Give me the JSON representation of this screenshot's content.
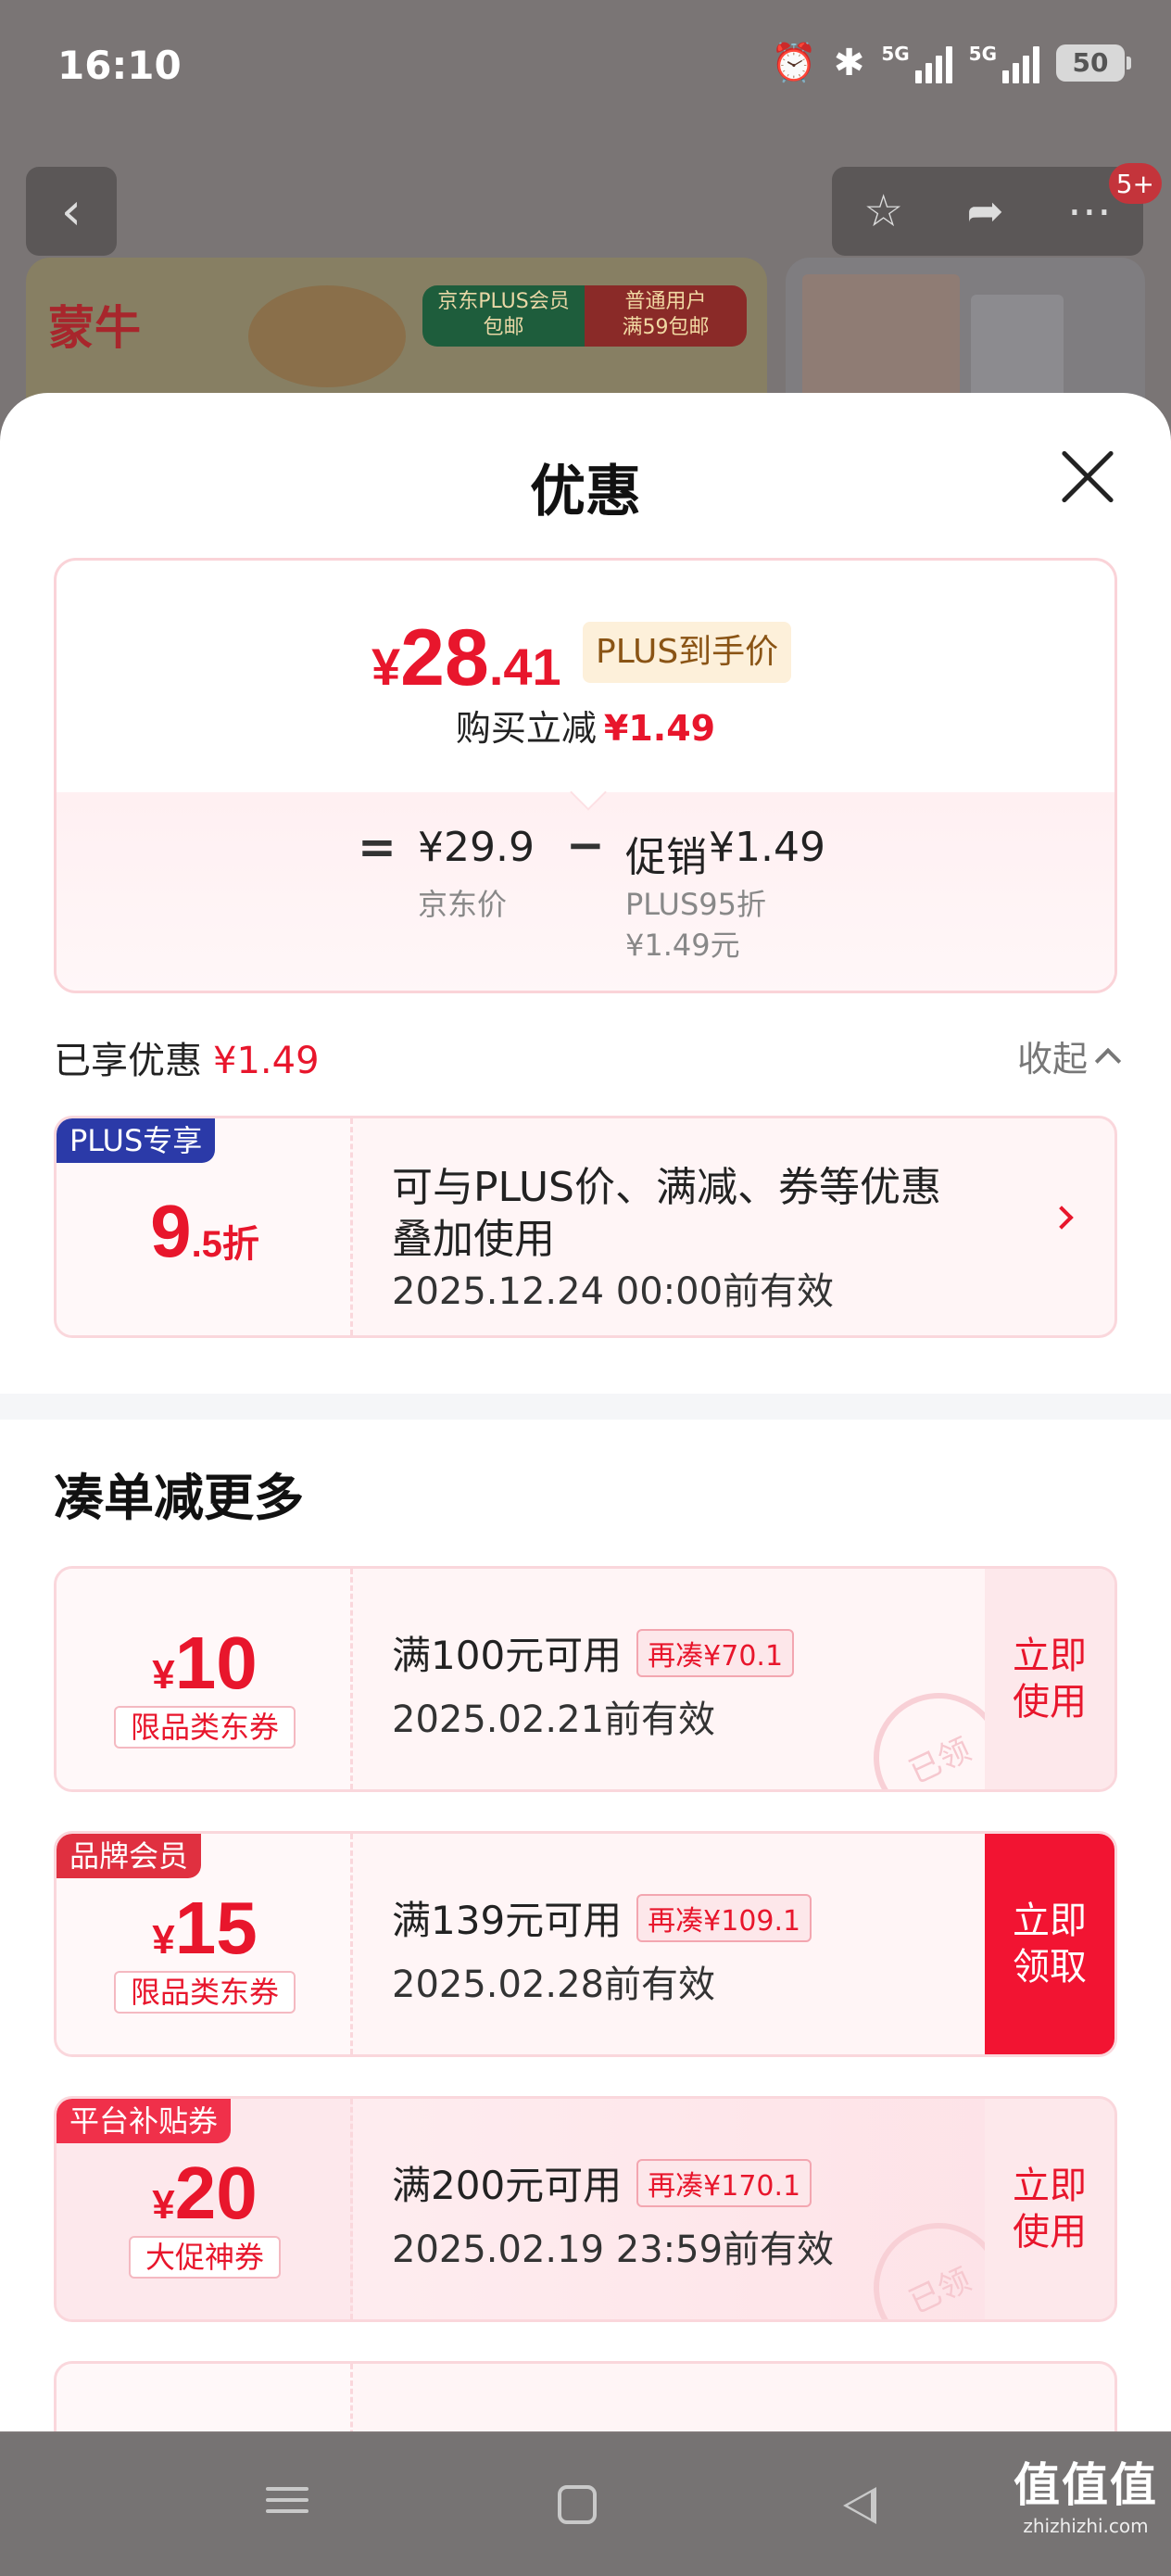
{
  "status_bar": {
    "time": "16:10",
    "alarm_icon": "alarm-icon",
    "bluetooth_icon": "bluetooth-icon",
    "signal_labels": [
      "5G",
      "5G"
    ],
    "battery": "50"
  },
  "background": {
    "brand": "蒙牛",
    "badge_left_line1": "京东PLUS会员",
    "badge_left_line2": "包邮",
    "badge_right_line1": "普通用户",
    "badge_right_line2": "满59包邮",
    "notification_badge": "5+"
  },
  "sheet": {
    "title": "优惠",
    "price": {
      "currency": "¥",
      "integer": "28",
      "decimal": ".41",
      "tag": "PLUS到手价",
      "instant_reduce_label": "购买立减",
      "instant_reduce_amount": "¥1.49",
      "breakdown": {
        "equals": "=",
        "jd_price": "¥29.9",
        "jd_price_label": "京东价",
        "minus": "−",
        "promo_label": "促销",
        "promo_amount": "¥1.49",
        "promo_desc1": "PLUS95折",
        "promo_desc2": "¥1.49元"
      }
    },
    "enjoyed": {
      "label": "已享优惠",
      "amount": "¥1.49",
      "collapse": "收起"
    },
    "plus_coupon": {
      "tag": "PLUS专享",
      "discount_big": "9",
      "discount_small": ".5折",
      "line1": "可与PLUS价、满减、券等优惠",
      "line2": "叠加使用",
      "valid": "2025.12.24 00:00前有效"
    },
    "section_title": "凑单减更多",
    "coupons": [
      {
        "tag": "",
        "currency": "¥",
        "value": "10",
        "kind": "限品类东券",
        "condition": "满100元可用",
        "need": "再凑¥70.1",
        "valid": "2025.02.21前有效",
        "action_line1": "立即",
        "action_line2": "使用",
        "stamp": "已领"
      },
      {
        "tag": "品牌会员",
        "currency": "¥",
        "value": "15",
        "kind": "限品类东券",
        "condition": "满139元可用",
        "need": "再凑¥109.1",
        "valid": "2025.02.28前有效",
        "action_line1": "立即",
        "action_line2": "领取",
        "stamp": ""
      },
      {
        "tag": "平台补贴券",
        "currency": "¥",
        "value": "20",
        "kind": "大促神券",
        "condition": "满200元可用",
        "need": "再凑¥170.1",
        "valid": "2025.02.19 23:59前有效",
        "action_line1": "立即",
        "action_line2": "使用",
        "stamp": "已领"
      }
    ]
  },
  "watermark": {
    "main": "值值值",
    "sub": "zhizhizhi.com"
  },
  "colors": {
    "accent_red": "#e8162c",
    "plus_blue": "#2b3aa8",
    "brand_member_red": "#e03040",
    "platform_red": "#f0304a"
  }
}
